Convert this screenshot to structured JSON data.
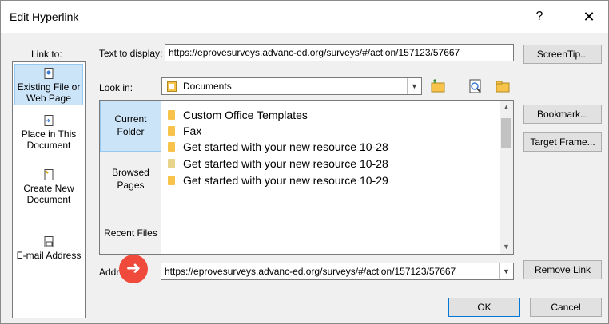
{
  "window": {
    "title": "Edit Hyperlink",
    "help_label": "?",
    "close_label": "✕"
  },
  "link_to": {
    "label": "Link to:",
    "items": [
      {
        "label": "Existing File or Web Page",
        "icon": "existing-file-icon",
        "selected": true
      },
      {
        "label": "Place in This Document",
        "icon": "place-in-document-icon",
        "selected": false
      },
      {
        "label": "Create New Document",
        "icon": "new-document-icon",
        "selected": false
      },
      {
        "label": "E-mail Address",
        "icon": "email-icon",
        "selected": false
      }
    ]
  },
  "text_to_display": {
    "label": "Text to display:",
    "value": "https://eprovesurveys.advanc-ed.org/surveys/#/action/157123/57667"
  },
  "screentip_label": "ScreenTip...",
  "look_in": {
    "label": "Look in:",
    "value": "Documents"
  },
  "subnav": [
    {
      "label": "Current Folder",
      "selected": true
    },
    {
      "label": "Browsed Pages",
      "selected": false
    },
    {
      "label": "Recent Files",
      "selected": false
    }
  ],
  "files": [
    "Custom Office Templates",
    "Fax",
    "Get started with your new resource 10-28",
    "Get started with your new resource 10-28",
    "Get started with your new resource 10-29"
  ],
  "bookmark_label": "Bookmark...",
  "target_frame_label": "Target Frame...",
  "address": {
    "label": "Address:",
    "value": "https://eprovesurveys.advanc-ed.org/surveys/#/action/157123/57667"
  },
  "remove_link_label": "Remove Link",
  "ok_label": "OK",
  "cancel_label": "Cancel",
  "colors": {
    "accent": "#cce4f7",
    "arrow": "#f04a3d",
    "folder": "#f7c34b"
  }
}
